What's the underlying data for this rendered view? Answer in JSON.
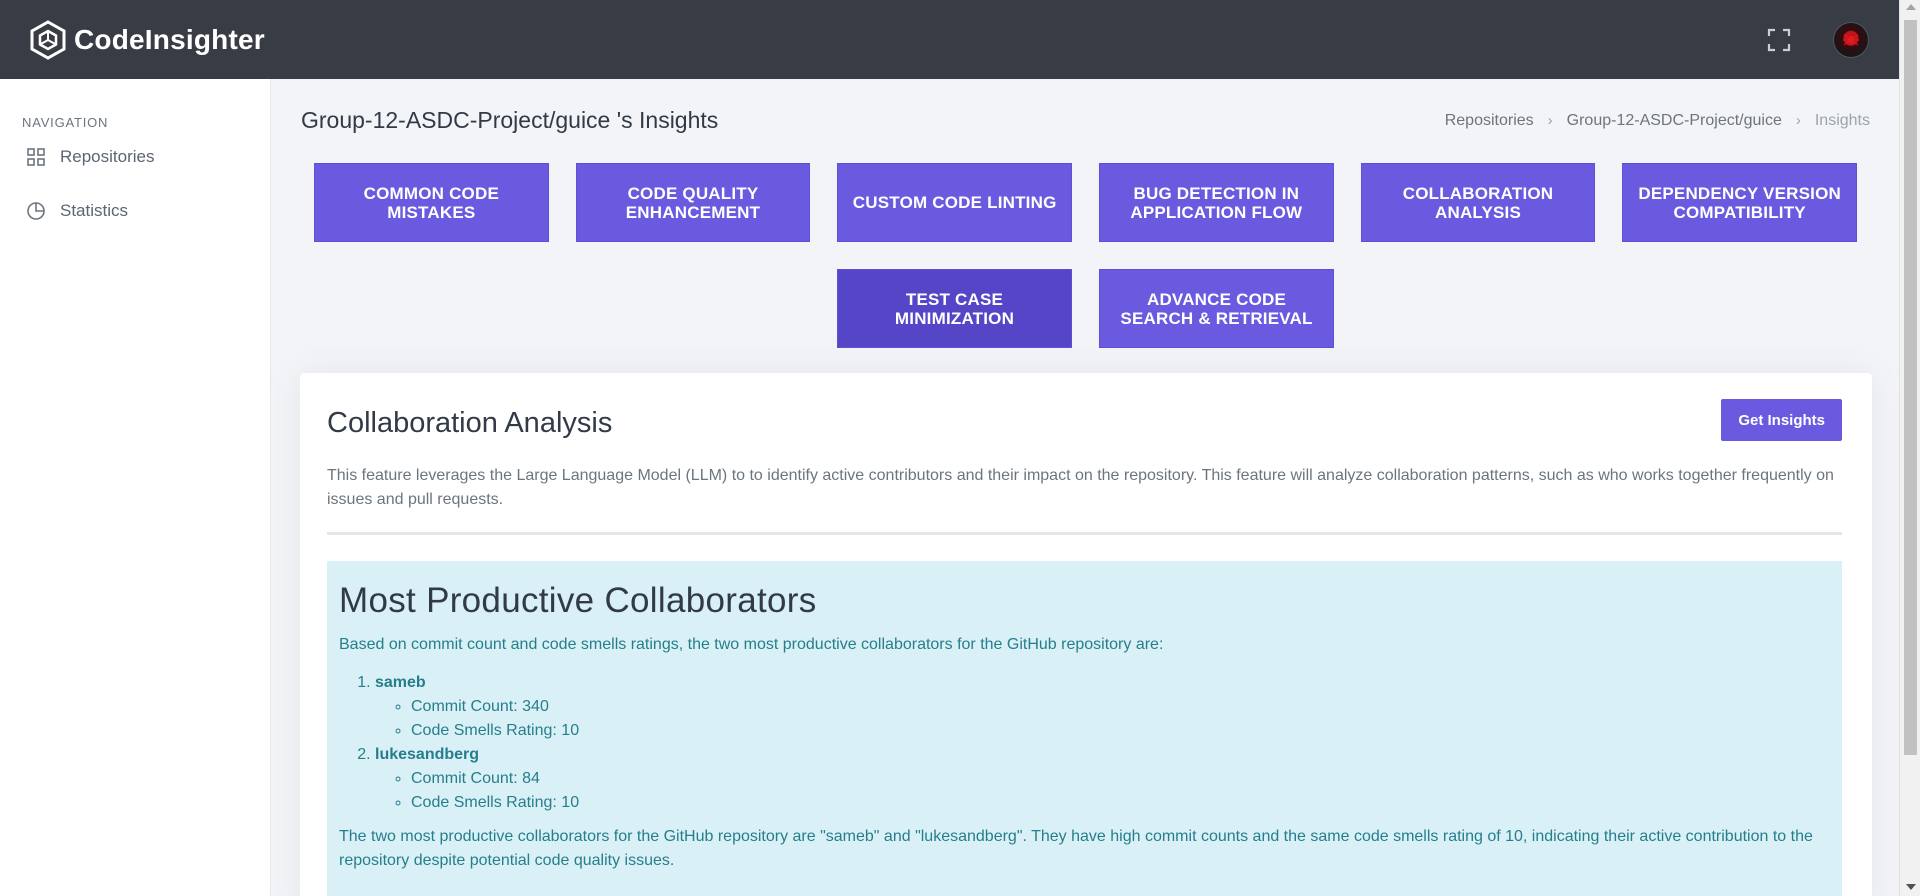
{
  "header": {
    "brand": "CodeInsighter"
  },
  "sidebar": {
    "title": "NAVIGATION",
    "items": [
      {
        "label": "Repositories",
        "icon": "grid-icon"
      },
      {
        "label": "Statistics",
        "icon": "pie-chart-icon"
      }
    ]
  },
  "page": {
    "title": "Group-12-ASDC-Project/guice 's Insights",
    "breadcrumb": [
      "Repositories",
      "Group-12-ASDC-Project/guice",
      "Insights"
    ]
  },
  "features": {
    "row1": [
      "COMMON CODE MISTAKES",
      "CODE QUALITY ENHANCEMENT",
      "CUSTOM CODE LINTING",
      "BUG DETECTION IN APPLICATION FLOW",
      "COLLABORATION ANALYSIS",
      "DEPENDENCY VERSION COMPATIBILITY"
    ],
    "row2": [
      "TEST CASE MINIMIZATION",
      "ADVANCE CODE SEARCH & RETRIEVAL"
    ],
    "active": "TEST CASE MINIMIZATION"
  },
  "card": {
    "title": "Collaboration Analysis",
    "button": "Get Insights",
    "description": "This feature leverages the Large Language Model (LLM) to to identify active contributors and their impact on the repository. This feature will analyze collaboration patterns, such as who works together frequently on issues and pull requests."
  },
  "result": {
    "heading": "Most Productive Collaborators",
    "intro": "Based on commit count and code smells ratings, the two most productive collaborators for the GitHub repository are:",
    "collaborators": [
      {
        "name": "sameb",
        "commit": "Commit Count: 340",
        "smells": "Code Smells Rating: 10"
      },
      {
        "name": "lukesandberg",
        "commit": "Commit Count: 84",
        "smells": "Code Smells Rating: 10"
      }
    ],
    "conclusion": "The two most productive collaborators for the GitHub repository are \"sameb\" and \"lukesandberg\". They have high commit counts and the same code smells rating of 10, indicating their active contribution to the repository despite potential code quality issues."
  },
  "colors": {
    "accent": "#6a5ae0",
    "topbar": "#383d45",
    "result_bg": "#d9f1f6",
    "result_text": "#267e8c"
  }
}
